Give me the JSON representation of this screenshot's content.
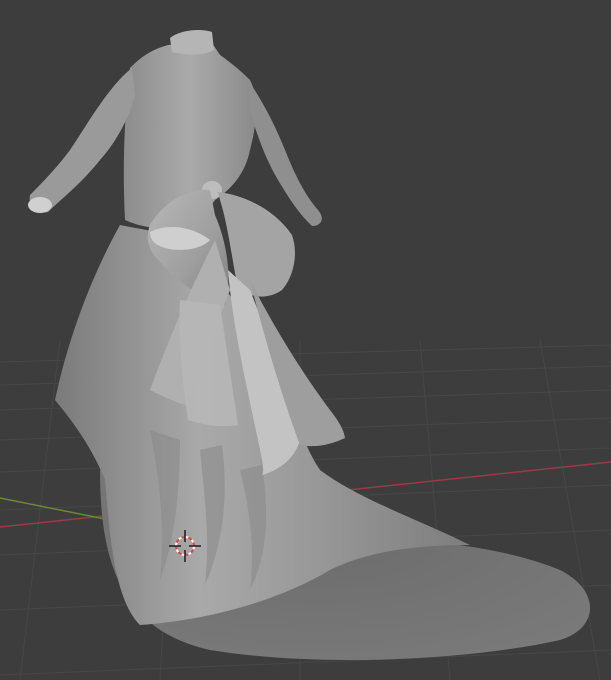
{
  "app": {
    "view": "3D Viewport",
    "shading_mode": "solid"
  },
  "colors": {
    "background": "#3d3d3d",
    "grid_line": "#4a4a4a",
    "x_axis": "#9a3a45",
    "y_axis": "#6b8a2f",
    "mesh_base": "#8f8f8f",
    "mesh_light": "#b9b9b9",
    "mesh_dark": "#6e6e6e",
    "floor_shadow": "#777777",
    "cursor_red": "#e0463c",
    "cursor_white": "#ffffff"
  },
  "scene": {
    "object": "dress-mesh",
    "shows_3d_cursor": true,
    "shows_floor_grid": true,
    "shows_axis_lines": true
  }
}
